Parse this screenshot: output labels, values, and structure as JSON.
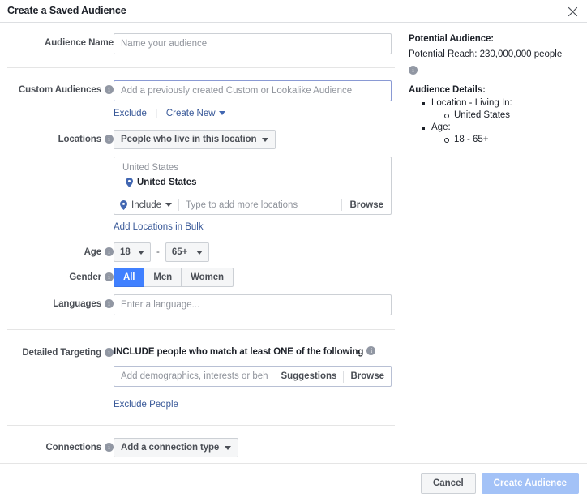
{
  "header": {
    "title": "Create a Saved Audience",
    "close_icon": "close-icon"
  },
  "form": {
    "audience_name": {
      "label": "Audience Name",
      "placeholder": "Name your audience",
      "value": ""
    },
    "custom_audiences": {
      "label": "Custom Audiences",
      "placeholder": "Add a previously created Custom or Lookalike Audience",
      "value": "",
      "exclude_link": "Exclude",
      "create_new_link": "Create New"
    },
    "locations": {
      "label": "Locations",
      "type_dropdown": "People who live in this location",
      "group_header": "United States",
      "selected": "United States",
      "include_label": "Include",
      "type_placeholder": "Type to add more locations",
      "browse_label": "Browse",
      "bulk_link": "Add Locations in Bulk"
    },
    "age": {
      "label": "Age",
      "min": "18",
      "max": "65+",
      "separator": "-"
    },
    "gender": {
      "label": "Gender",
      "options": [
        "All",
        "Men",
        "Women"
      ],
      "selected": "All"
    },
    "languages": {
      "label": "Languages",
      "placeholder": "Enter a language...",
      "value": ""
    },
    "detailed_targeting": {
      "label": "Detailed Targeting",
      "include_title": "INCLUDE people who match at least ONE of the following",
      "placeholder": "Add demographics, interests or behaviors",
      "suggestions_label": "Suggestions",
      "browse_label": "Browse",
      "exclude_link": "Exclude People"
    },
    "connections": {
      "label": "Connections",
      "dropdown": "Add a connection type"
    }
  },
  "right_panel": {
    "potential_audience_title": "Potential Audience:",
    "potential_reach": "Potential Reach: 230,000,000 people",
    "audience_details_title": "Audience Details:",
    "details": [
      {
        "label": "Location - Living In:",
        "sub": [
          "United States"
        ]
      },
      {
        "label": "Age:",
        "sub": [
          "18 - 65+"
        ]
      }
    ]
  },
  "footer": {
    "cancel_label": "Cancel",
    "create_label": "Create Audience"
  },
  "colors": {
    "accent_blue": "#4080ff",
    "link_blue": "#385898",
    "primary_disabled": "#a3c2f7",
    "pin_blue": "#4267b2"
  }
}
